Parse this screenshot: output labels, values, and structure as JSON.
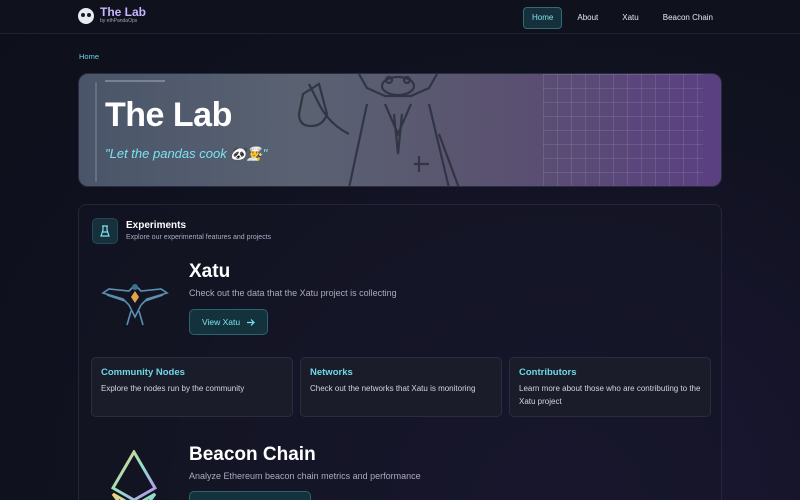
{
  "brand": {
    "title": "The Lab",
    "subtitle": "by ethPandaOps",
    "logo_icon": "panda-logo-icon"
  },
  "nav": {
    "items": [
      {
        "label": "Home",
        "active": true
      },
      {
        "label": "About",
        "active": false
      },
      {
        "label": "Xatu",
        "active": false
      },
      {
        "label": "Beacon Chain",
        "active": false
      }
    ]
  },
  "breadcrumb": {
    "home": "Home"
  },
  "hero": {
    "title": "The Lab",
    "tagline": "\"Let the pandas cook 🐼👨‍🍳\""
  },
  "experiments": {
    "icon": "flask-icon",
    "title": "Experiments",
    "subtitle": "Explore our experimental features and projects",
    "xatu": {
      "title": "Xatu",
      "description": "Check out the data that the Xatu project is collecting",
      "button_label": "View Xatu",
      "button_icon": "arrow-right-icon",
      "cards": [
        {
          "title": "Community Nodes",
          "description": "Explore the nodes run by the community"
        },
        {
          "title": "Networks",
          "description": "Check out the networks that Xatu is monitoring"
        },
        {
          "title": "Contributors",
          "description": "Learn more about those who are contributing to the Xatu project"
        }
      ]
    },
    "beacon_chain": {
      "title": "Beacon Chain",
      "description": "Analyze Ethereum beacon chain metrics and performance"
    }
  },
  "colors": {
    "accent": "#78e3ef",
    "brand": "#c7b6ff",
    "background": "#111221"
  }
}
